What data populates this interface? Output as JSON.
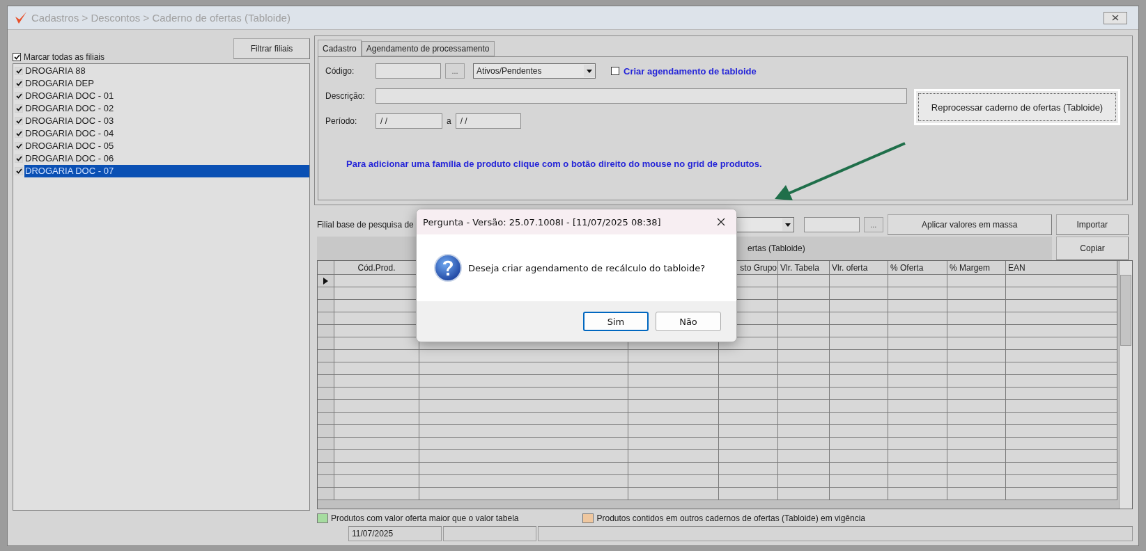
{
  "window": {
    "title": "Cadastros > Descontos > Caderno de ofertas (Tabloide)"
  },
  "branches": {
    "select_all": {
      "label": "Marcar todas as filiais",
      "checked": true
    },
    "filter_button": "Filtrar filiais",
    "items": [
      {
        "label": "DROGARIA 88",
        "checked": true,
        "selected": false
      },
      {
        "label": "DROGARIA DEP",
        "checked": true,
        "selected": false
      },
      {
        "label": "DROGARIA DOC - 01",
        "checked": true,
        "selected": false
      },
      {
        "label": "DROGARIA DOC - 02",
        "checked": true,
        "selected": false
      },
      {
        "label": "DROGARIA DOC - 03",
        "checked": true,
        "selected": false
      },
      {
        "label": "DROGARIA DOC - 04",
        "checked": true,
        "selected": false
      },
      {
        "label": "DROGARIA DOC - 05",
        "checked": true,
        "selected": false
      },
      {
        "label": "DROGARIA DOC - 06",
        "checked": true,
        "selected": false
      },
      {
        "label": "DROGARIA DOC - 07",
        "checked": true,
        "selected": true
      }
    ]
  },
  "tabs": [
    {
      "label": "Cadastro",
      "selected": true
    },
    {
      "label": "Agendamento de processamento",
      "selected": false
    }
  ],
  "form": {
    "code_label": "Código:",
    "browse_button": "...",
    "status_select": "Ativos/Pendentes",
    "schedule_checkbox": {
      "label": "Criar agendamento de tabloide",
      "checked": false
    },
    "description_label": "Descrição:",
    "period_label": "Período:",
    "period_from": "/ /",
    "period_separator": "a",
    "period_to": "/ /",
    "reprocess_button": "Reprocessar caderno de ofertas (Tabloide)",
    "hint": "Para adicionar uma família de produto clique com o botão direito do  mouse no grid de produtos."
  },
  "products": {
    "base_branch_label": "Filial base de pesquisa de",
    "browse_button": "...",
    "apply_button": "Aplicar valores em massa",
    "import_button": "Importar",
    "section_title": "ertas (Tabloide)",
    "copy_button": "Copiar",
    "columns": [
      {
        "label": "Cód.Prod."
      },
      {
        "label": "sto Grupo"
      },
      {
        "label": "Vlr. Tabela"
      },
      {
        "label": "Vlr. oferta"
      },
      {
        "label": "% Oferta"
      },
      {
        "label": "% Margem"
      },
      {
        "label": "EAN"
      }
    ]
  },
  "legend": [
    {
      "label": "Produtos com valor oferta maior que o valor tabela",
      "color": "#a6dca0"
    },
    {
      "label": "Produtos contidos em outros cadernos de ofertas (Tabloide) em vigência",
      "color": "#efc79f"
    }
  ],
  "status_bar": {
    "date": "11/07/2025"
  },
  "dialog": {
    "title": "Pergunta - Versão: 25.07.1008I - [11/07/2025 08:38]",
    "message": "Deseja criar agendamento de recálculo do tabloide?",
    "buttons": [
      {
        "label": "Sim",
        "selected": true
      },
      {
        "label": "Não",
        "selected": false
      }
    ]
  }
}
